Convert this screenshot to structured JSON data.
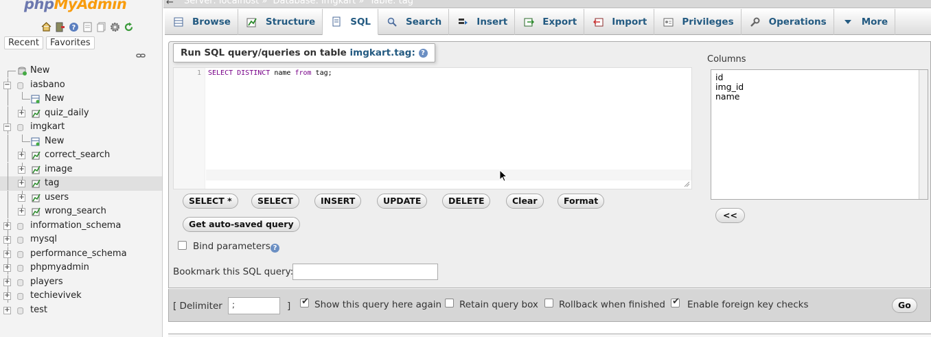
{
  "nav": {
    "logo_part1": "php",
    "logo_part2": "MyAdmin",
    "tab_recent": "Recent",
    "tab_favorites": "Favorites",
    "tree": [
      {
        "label": "New",
        "level": 0,
        "kind": "new"
      },
      {
        "label": "iasbano",
        "level": 0,
        "kind": "db"
      },
      {
        "label": "New",
        "level": 1,
        "kind": "new"
      },
      {
        "label": "quiz_daily",
        "level": 1,
        "kind": "table"
      },
      {
        "label": "imgkart",
        "level": 0,
        "kind": "db"
      },
      {
        "label": "New",
        "level": 1,
        "kind": "new"
      },
      {
        "label": "correct_search",
        "level": 1,
        "kind": "table"
      },
      {
        "label": "image",
        "level": 1,
        "kind": "table"
      },
      {
        "label": "tag",
        "level": 1,
        "kind": "table",
        "selected": true
      },
      {
        "label": "users",
        "level": 1,
        "kind": "table"
      },
      {
        "label": "wrong_search",
        "level": 1,
        "kind": "table"
      },
      {
        "label": "information_schema",
        "level": 0,
        "kind": "db"
      },
      {
        "label": "mysql",
        "level": 0,
        "kind": "db"
      },
      {
        "label": "performance_schema",
        "level": 0,
        "kind": "db"
      },
      {
        "label": "phpmyadmin",
        "level": 0,
        "kind": "db"
      },
      {
        "label": "players",
        "level": 0,
        "kind": "db"
      },
      {
        "label": "techievivek",
        "level": 0,
        "kind": "db"
      },
      {
        "label": "test",
        "level": 0,
        "kind": "db"
      }
    ]
  },
  "breadcrumb": {
    "server": "Server: localhost »",
    "database": "Database: imgkart »",
    "table": "Table: tag"
  },
  "tabs": [
    {
      "label": "Browse",
      "icon": "browse-icon"
    },
    {
      "label": "Structure",
      "icon": "structure-icon"
    },
    {
      "label": "SQL",
      "icon": "sql-icon",
      "active": true
    },
    {
      "label": "Search",
      "icon": "search-icon"
    },
    {
      "label": "Insert",
      "icon": "insert-icon"
    },
    {
      "label": "Export",
      "icon": "export-icon"
    },
    {
      "label": "Import",
      "icon": "import-icon"
    },
    {
      "label": "Privileges",
      "icon": "privileges-icon"
    },
    {
      "label": "Operations",
      "icon": "operations-icon"
    },
    {
      "label": "More",
      "icon": "chevron-down-icon"
    }
  ],
  "sql": {
    "legend_prefix": "Run SQL query/queries on table",
    "legend_table": "imgkart.tag:",
    "line_number": "1",
    "query_kw1": "SELECT DISTINCT",
    "query_mid": " name ",
    "query_kw2": "from",
    "query_end": " tag;",
    "buttons": {
      "select_star": "SELECT *",
      "select": "SELECT",
      "insert": "INSERT",
      "update": "UPDATE",
      "delete": "DELETE",
      "clear": "Clear",
      "format": "Format",
      "get_autosaved": "Get auto-saved query"
    },
    "bind_parameters": "Bind parameters",
    "bookmark_label": "Bookmark this SQL query:",
    "bookmark_value": ""
  },
  "columns": {
    "label": "Columns",
    "items": [
      "id",
      "img_id",
      "name"
    ],
    "insert_button": "<<"
  },
  "footer": {
    "delimiter_open": "[ Delimiter",
    "delimiter_value": ";",
    "delimiter_close": "]",
    "show_query": "Show this query here again",
    "show_query_checked": true,
    "retain_box": "Retain query box",
    "retain_box_checked": false,
    "rollback": "Rollback when finished",
    "rollback_checked": false,
    "foreign_keys": "Enable foreign key checks",
    "foreign_keys_checked": true,
    "go": "Go"
  },
  "colors": {
    "accent": "#235a81",
    "logo_blue": "#6c78af",
    "logo_orange": "#f89c0e"
  }
}
